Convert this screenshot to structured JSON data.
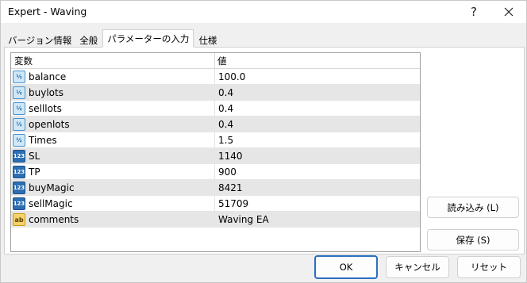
{
  "window": {
    "title": "Expert - Waving",
    "help_glyph": "?"
  },
  "tabs": [
    {
      "label": "バージョン情報",
      "active": false
    },
    {
      "label": "全般",
      "active": false
    },
    {
      "label": "パラメーターの入力",
      "active": true
    },
    {
      "label": "仕様",
      "active": false
    }
  ],
  "grid": {
    "columns": [
      "変数",
      "値"
    ],
    "rows": [
      {
        "type_icon": "double",
        "icon_text": "½",
        "name": "balance",
        "value": "100.0"
      },
      {
        "type_icon": "double",
        "icon_text": "½",
        "name": "buylots",
        "value": "0.4"
      },
      {
        "type_icon": "double",
        "icon_text": "½",
        "name": "selllots",
        "value": "0.4"
      },
      {
        "type_icon": "double",
        "icon_text": "½",
        "name": "openlots",
        "value": "0.4"
      },
      {
        "type_icon": "double",
        "icon_text": "½",
        "name": "Times",
        "value": "1.5"
      },
      {
        "type_icon": "int",
        "icon_text": "123",
        "name": "SL",
        "value": "1140"
      },
      {
        "type_icon": "int",
        "icon_text": "123",
        "name": "TP",
        "value": "900"
      },
      {
        "type_icon": "int",
        "icon_text": "123",
        "name": "buyMagic",
        "value": "8421"
      },
      {
        "type_icon": "int",
        "icon_text": "123",
        "name": "sellMagic",
        "value": "51709"
      },
      {
        "type_icon": "string",
        "icon_text": "ab",
        "name": "comments",
        "value": "Waving EA"
      }
    ]
  },
  "buttons": {
    "load": "読み込み (L)",
    "save": "保存 (S)",
    "ok": "OK",
    "cancel": "キャンセル",
    "reset": "リセット"
  },
  "colors": {
    "accent": "#2b6fbf",
    "row_alt": "#e6e6e6"
  }
}
